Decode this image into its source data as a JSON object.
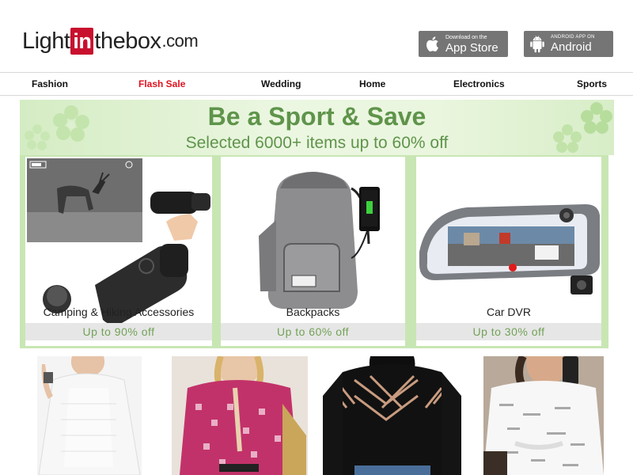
{
  "header": {
    "logo": {
      "light": "Light",
      "in": "in",
      "thebox": "thebox",
      "com": ".com"
    },
    "app_store": {
      "small": "Download on the",
      "big": "App Store",
      "icon": "apple-icon"
    },
    "android": {
      "small": "ANDROID APP ON",
      "big": "Android",
      "icon": "android-icon"
    }
  },
  "nav": {
    "items": [
      {
        "label": "Fashion"
      },
      {
        "label": "Flash Sale",
        "color": "#e0121f"
      },
      {
        "label": "Wedding"
      },
      {
        "label": "Home"
      },
      {
        "label": "Electronics"
      },
      {
        "label": "Sports"
      }
    ]
  },
  "banner": {
    "title": "Be a Sport & Save",
    "subtitle": "Selected 6000+ items up to 60% off",
    "accent": "#5f944b"
  },
  "categories": [
    {
      "label": "Camping & Hiking Accessories",
      "offer": "Up to 90% off"
    },
    {
      "label": "Backpacks",
      "offer": "Up to 60% off"
    },
    {
      "label": "Car DVR",
      "offer": "Up to 30% off"
    }
  ],
  "colors": {
    "brand_red": "#c8102e",
    "nav_highlight": "#e0121f",
    "offer_green": "#72a257",
    "store_button_gray": "#757575"
  }
}
